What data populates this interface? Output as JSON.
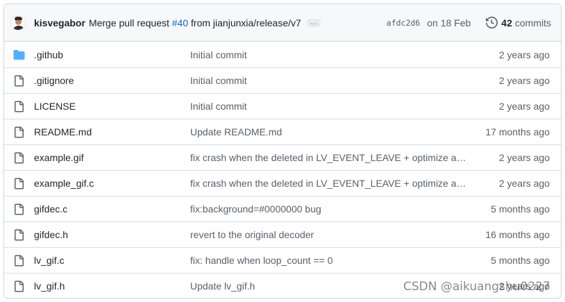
{
  "commit": {
    "author": "kisvegabor",
    "message_prefix": "Merge pull request",
    "pr_number": "#40",
    "message_suffix": "from jianjunxia/release/v7",
    "ellipsis": "…",
    "sha": "afdc2d6",
    "date": "on 18 Feb",
    "commit_count": "42",
    "commit_label": "commits"
  },
  "files": [
    {
      "name": ".github",
      "icon": "folder-icon",
      "message": "Initial commit",
      "age": "2 years ago"
    },
    {
      "name": ".gitignore",
      "icon": "file-icon",
      "message": "Initial commit",
      "age": "2 years ago"
    },
    {
      "name": "LICENSE",
      "icon": "file-icon",
      "message": "Initial commit",
      "age": "2 years ago"
    },
    {
      "name": "README.md",
      "icon": "file-icon",
      "message": "Update README.md",
      "age": "17 months ago"
    },
    {
      "name": "example.gif",
      "icon": "file-icon",
      "message": "fix crash when the deleted in LV_EVENT_LEAVE + optimize animation",
      "age": "2 years ago"
    },
    {
      "name": "example_gif.c",
      "icon": "file-icon",
      "message": "fix crash when the deleted in LV_EVENT_LEAVE + optimize animation",
      "age": "2 years ago"
    },
    {
      "name": "gifdec.c",
      "icon": "file-icon",
      "message": "fix:background=#0000000 bug",
      "age": "5 months ago"
    },
    {
      "name": "gifdec.h",
      "icon": "file-icon",
      "message": "revert to the original decoder",
      "age": "16 months ago"
    },
    {
      "name": "lv_gif.c",
      "icon": "file-icon",
      "message": "fix: handle when loop_count == 0",
      "age": "5 months ago"
    },
    {
      "name": "lv_gif.h",
      "icon": "file-icon",
      "message": "Update lv_gif.h",
      "age": "2 years ago"
    }
  ],
  "watermark": "CSDN @aikuangshu0227",
  "colors": {
    "link": "#0969da",
    "folder": "#54aeff",
    "muted": "#57606a",
    "border": "#d0d7de"
  }
}
